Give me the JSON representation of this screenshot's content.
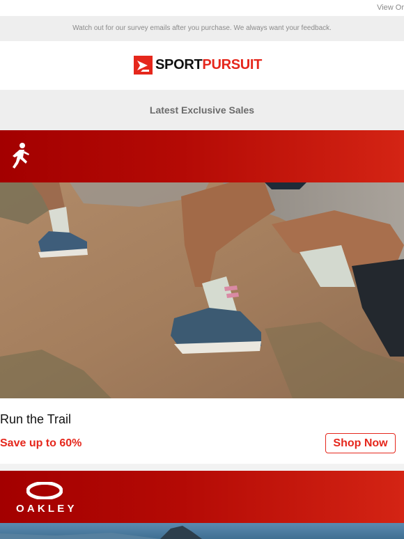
{
  "header": {
    "view_online_label": "View Or",
    "survey_notice": "Watch out for our survey emails after you purchase. We always want your feedback."
  },
  "brand": {
    "logo_part1": "SPORT",
    "logo_part2": "PURSUIT",
    "accent_color": "#e5271c"
  },
  "section": {
    "heading": "Latest Exclusive Sales"
  },
  "sales": [
    {
      "banner_icon": "runner-icon",
      "image": "trail-running-image",
      "title": "Run the Trail",
      "offer": "Save up to 60%",
      "cta": "Shop Now"
    },
    {
      "banner_logo_text": "OAKLEY",
      "banner_icon": "oakley-logo"
    }
  ]
}
